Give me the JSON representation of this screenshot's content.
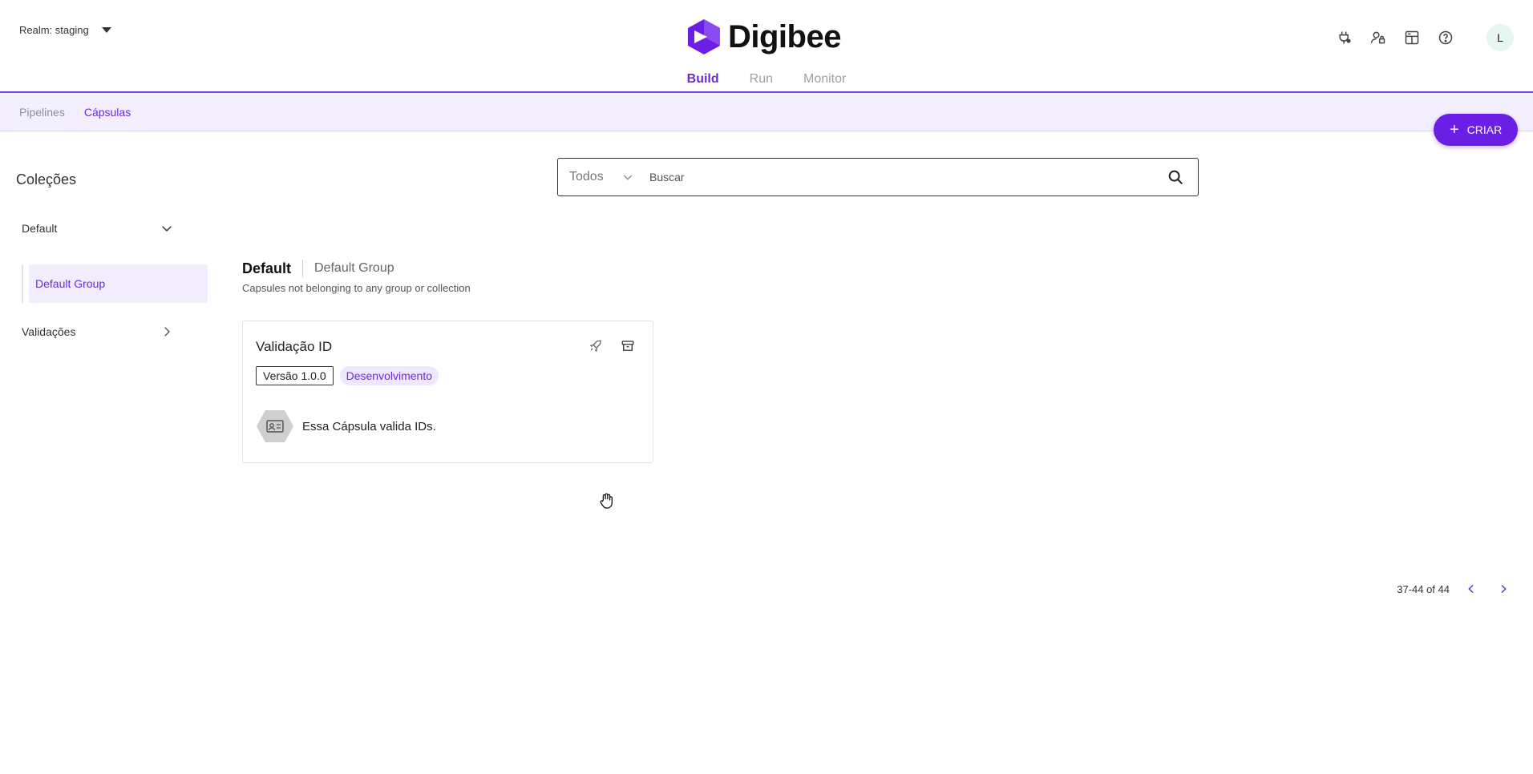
{
  "header": {
    "realm_label": "Realm: staging",
    "logo_text": "Digibee",
    "avatar_initial": "L",
    "icons": [
      "plug-icon",
      "user-lock-icon",
      "dashboard-icon",
      "help-icon"
    ]
  },
  "main_tabs": [
    {
      "label": "Build",
      "active": true
    },
    {
      "label": "Run",
      "active": false
    },
    {
      "label": "Monitor",
      "active": false
    }
  ],
  "subnav": [
    {
      "label": "Pipelines",
      "active": false
    },
    {
      "label": "Cápsulas",
      "active": true
    }
  ],
  "create_button": {
    "label": "CRIAR"
  },
  "sidebar": {
    "title": "Coleções",
    "collections": [
      {
        "label": "Default",
        "expanded": true,
        "groups": [
          {
            "label": "Default Group",
            "selected": true
          }
        ]
      },
      {
        "label": "Validações",
        "expanded": false
      }
    ]
  },
  "search": {
    "filter_value": "Todos",
    "placeholder": "Buscar"
  },
  "content": {
    "title": "Default",
    "subtitle": "Default Group",
    "description": "Capsules not belonging to any group or collection"
  },
  "capsule_card": {
    "title": "Validação ID",
    "version": "Versão 1.0.0",
    "status": "Desenvolvimento",
    "description": "Essa Cápsula valida IDs."
  },
  "pagination": {
    "range": "37-44 of 44"
  },
  "colors": {
    "accent": "#6b2bd9",
    "brand_button": "#6b1fe6",
    "subnav_bg": "#f3efff"
  }
}
